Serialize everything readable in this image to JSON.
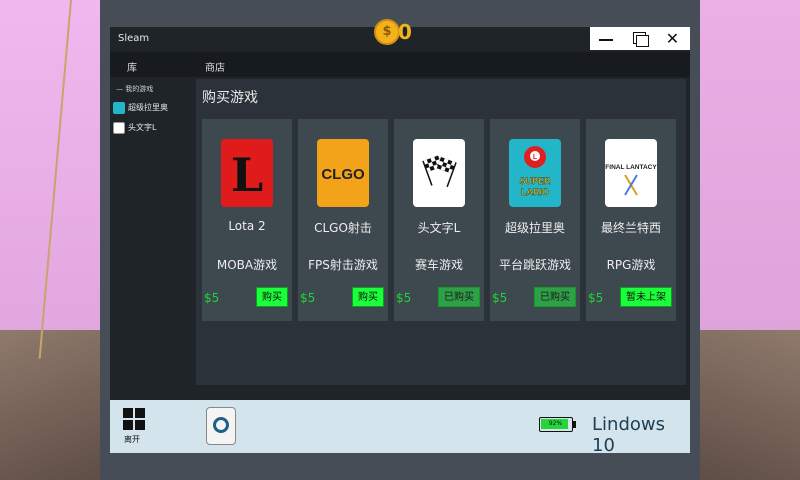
{
  "window": {
    "title": "Sleam",
    "coin_symbol": "$",
    "coin_count": "0",
    "minimize_label": "",
    "maximize_label": "",
    "close_label": "✕"
  },
  "tabs": {
    "library": "库",
    "store": "商店"
  },
  "sidebar": {
    "header": "— 我的游戏",
    "items": [
      {
        "label": "超级拉里奥",
        "icon": "mario-thumb-icon"
      },
      {
        "label": "头文字L",
        "icon": "racing-flags-thumb-icon"
      }
    ]
  },
  "store": {
    "title": "购买游戏",
    "games": [
      {
        "name": "Lota 2",
        "genre": "MOBA游戏",
        "price": "$5",
        "action": "购买",
        "logo_text": "L",
        "color": "#e01b1b"
      },
      {
        "name": "CLGO射击",
        "genre": "FPS射击游戏",
        "price": "$5",
        "action": "购买",
        "logo_text": "CLGO",
        "color": "#f2a31a"
      },
      {
        "name": "头文字L",
        "genre": "赛车游戏",
        "price": "$5",
        "action": "已购买",
        "logo_text": "",
        "color": "#ffffff"
      },
      {
        "name": "超级拉里奥",
        "genre": "平台跳跃游戏",
        "price": "$5",
        "action": "已购买",
        "logo_text": "SUPER LARIO",
        "color": "#23b6c9"
      },
      {
        "name": "最终兰特西",
        "genre": "RPG游戏",
        "price": "$5",
        "action": "暂未上架",
        "logo_text": "FINAL LANTACY",
        "color": "#ffffff"
      }
    ]
  },
  "taskbar": {
    "start_label": "离开",
    "battery": "92%",
    "battery_level": 0.92,
    "os_name": "Lindows 10"
  },
  "colors": {
    "accent_green": "#19ff3a",
    "price_green": "#19d63a",
    "coin_gold": "#f3b21b"
  }
}
